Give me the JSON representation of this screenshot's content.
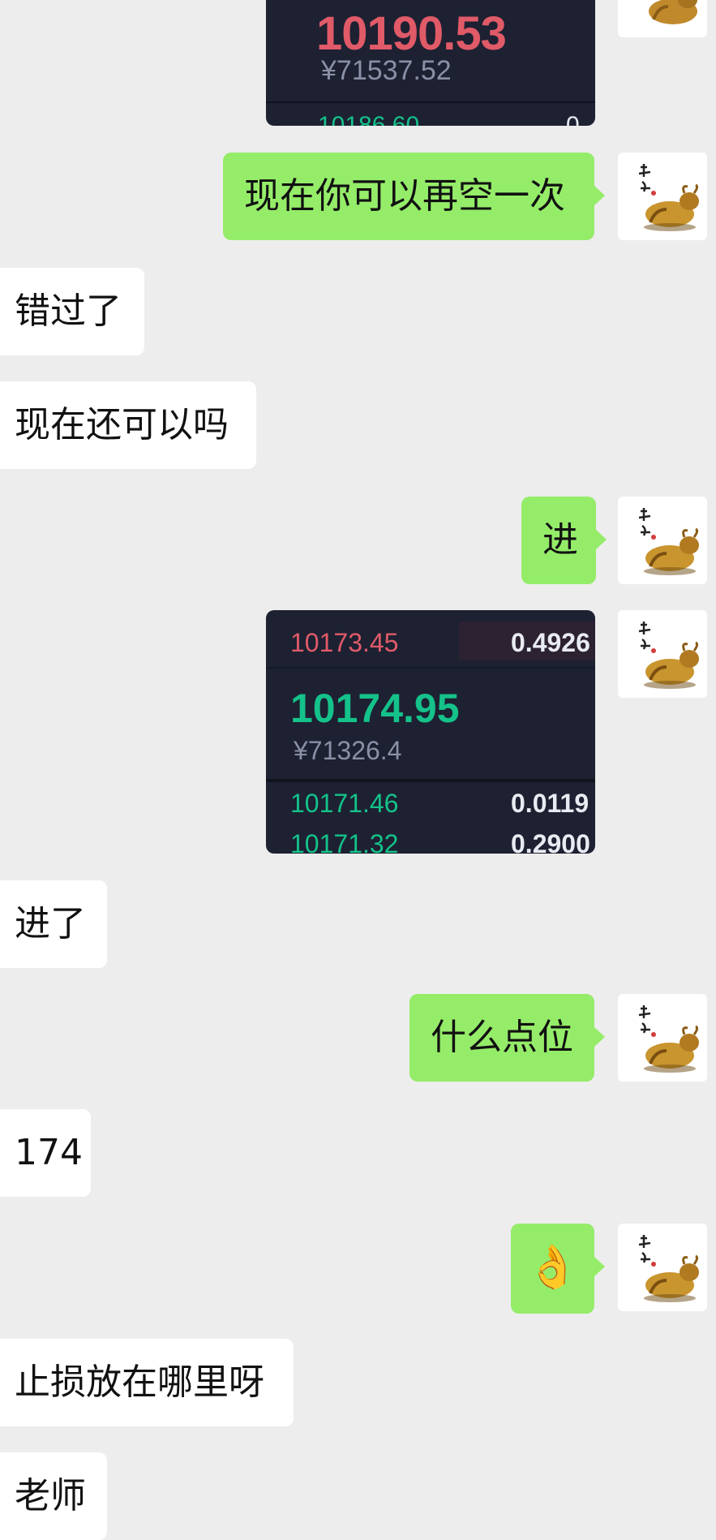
{
  "messages": [
    {
      "id": "m1",
      "side": "out",
      "type": "image",
      "ticker": {
        "price_main": "10190.53",
        "price_cny": "¥71537.52",
        "bottom_partial": "10186.60",
        "bottom_right_partial": "0"
      }
    },
    {
      "id": "m2",
      "side": "out",
      "type": "text",
      "text": "现在你可以再空一次"
    },
    {
      "id": "m3",
      "side": "in",
      "type": "text",
      "text": "错过了"
    },
    {
      "id": "m4",
      "side": "in",
      "type": "text",
      "text": "现在还可以吗"
    },
    {
      "id": "m5",
      "side": "out",
      "type": "text",
      "text": "进"
    },
    {
      "id": "m6",
      "side": "out",
      "type": "image",
      "ticker": {
        "ask_price": "10173.45",
        "ask_amount": "0.4926",
        "price_main": "10174.95",
        "price_cny": "¥71326.4",
        "bid1_price": "10171.46",
        "bid1_amount": "0.0119",
        "bid2_price": "10171.32",
        "bid2_amount": "0.2900"
      }
    },
    {
      "id": "m7",
      "side": "in",
      "type": "text",
      "text": "进了"
    },
    {
      "id": "m8",
      "side": "out",
      "type": "text",
      "text": "什么点位"
    },
    {
      "id": "m9",
      "side": "in",
      "type": "text",
      "text": "174"
    },
    {
      "id": "m10",
      "side": "out",
      "type": "emoji",
      "text": "👌"
    },
    {
      "id": "m11",
      "side": "in",
      "type": "text",
      "text": "止损放在哪里呀"
    },
    {
      "id": "m12",
      "side": "in",
      "type": "text",
      "text": "老师"
    }
  ],
  "colors": {
    "background": "#ededed",
    "incoming_bubble": "#ffffff",
    "outgoing_bubble": "#95ec69",
    "ticker_bg": "#1d2132",
    "ticker_red": "#e05a68",
    "ticker_green": "#14c28a"
  },
  "icons": {
    "avatar": "golden-ox-avatar-icon"
  }
}
